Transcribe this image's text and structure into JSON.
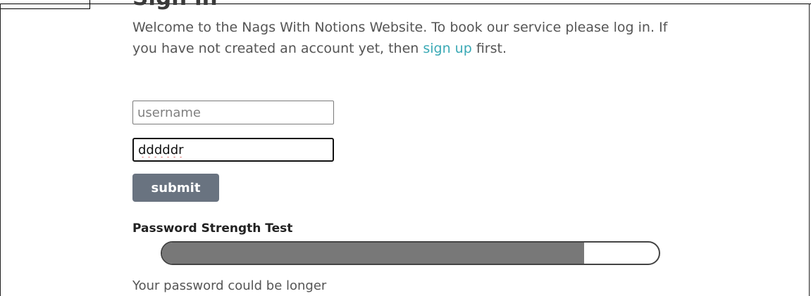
{
  "page": {
    "title": "Sign in"
  },
  "intro": {
    "text_before_link": "Welcome to the Nags With Notions Website. To book our service please log in. If you have not created an account yet, then ",
    "link_label": "sign up",
    "text_after_link": " first."
  },
  "form": {
    "username": {
      "value": "",
      "placeholder": "username"
    },
    "password": {
      "value": "dddddr",
      "placeholder": ""
    },
    "submit_label": "submit"
  },
  "strength": {
    "heading": "Password Strength Test",
    "level": 0.85,
    "message": "Your password could be longer"
  },
  "colors": {
    "link": "#3aa9b5",
    "button": "#697380",
    "meter_fill": "#787878"
  }
}
